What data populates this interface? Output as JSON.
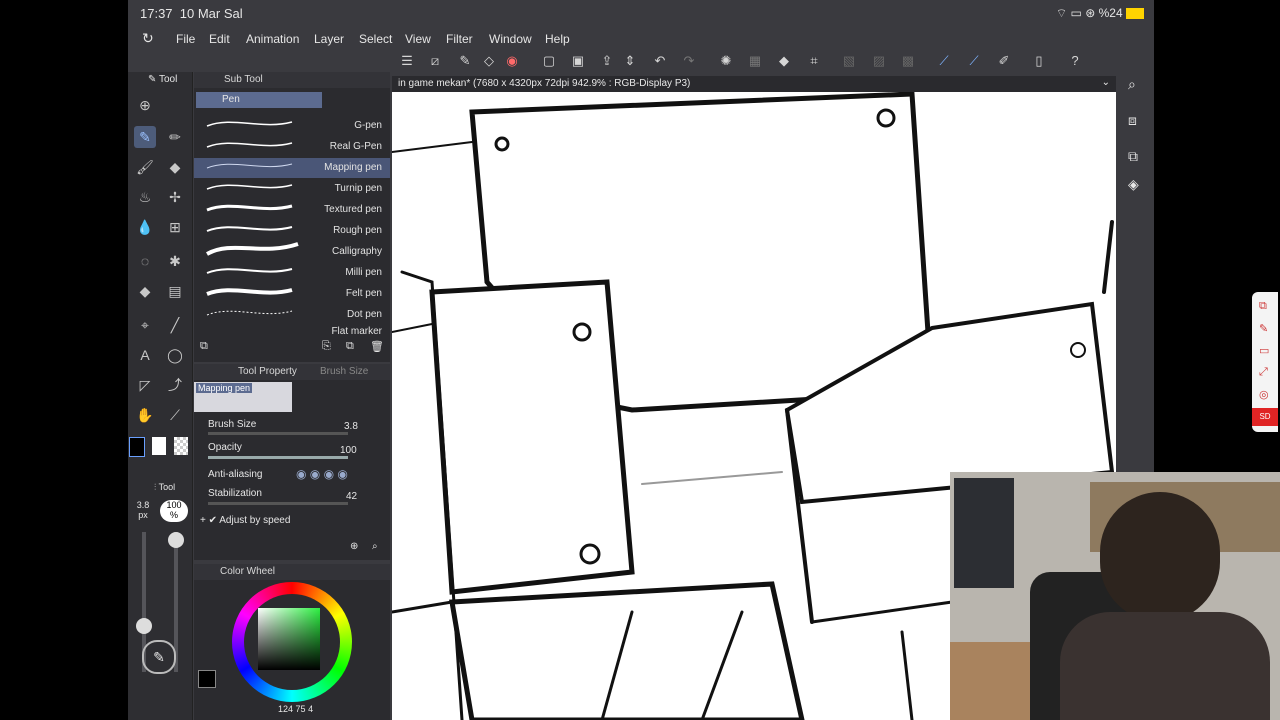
{
  "status": {
    "time": "17:37",
    "date": "10 Mar Sal",
    "battery": "%24"
  },
  "menu": [
    "File",
    "Edit",
    "Animation",
    "Layer",
    "Select",
    "View",
    "Filter",
    "Window",
    "Help"
  ],
  "canvas_title": "in game mekan* (7680 x 4320px 72dpi 942.9% : RGB-Display P3)",
  "subtool": {
    "tab_tool": "Tool",
    "tab_subtool": "Sub Tool",
    "group": "Pen",
    "brushes": [
      "G-pen",
      "Real G-Pen",
      "Mapping pen",
      "Turnip pen",
      "Textured pen",
      "Rough pen",
      "Calligraphy",
      "Milli pen",
      "Felt pen",
      "Dot pen",
      "Flat marker"
    ],
    "selected_index": 2
  },
  "tool_property": {
    "tab": "Tool Property",
    "tab2": "Brush Size",
    "preview_name": "Mapping pen",
    "brush_size_label": "Brush Size",
    "brush_size": "3.8",
    "opacity_label": "Opacity",
    "opacity": "100",
    "antialias_label": "Anti-aliasing",
    "stabilization_label": "Stabilization",
    "stabilization": "42",
    "adjust_label": "Adjust by speed"
  },
  "left_readout": {
    "size": "3.8",
    "size_unit": "px",
    "opacity": "100",
    "opacity_unit": "%",
    "tool_label": "Tool"
  },
  "color": {
    "tab": "Color Wheel",
    "hsv": "124",
    "s": "75",
    "v": "4",
    "main_color": "#000000",
    "sub_color": "#ffffff"
  }
}
